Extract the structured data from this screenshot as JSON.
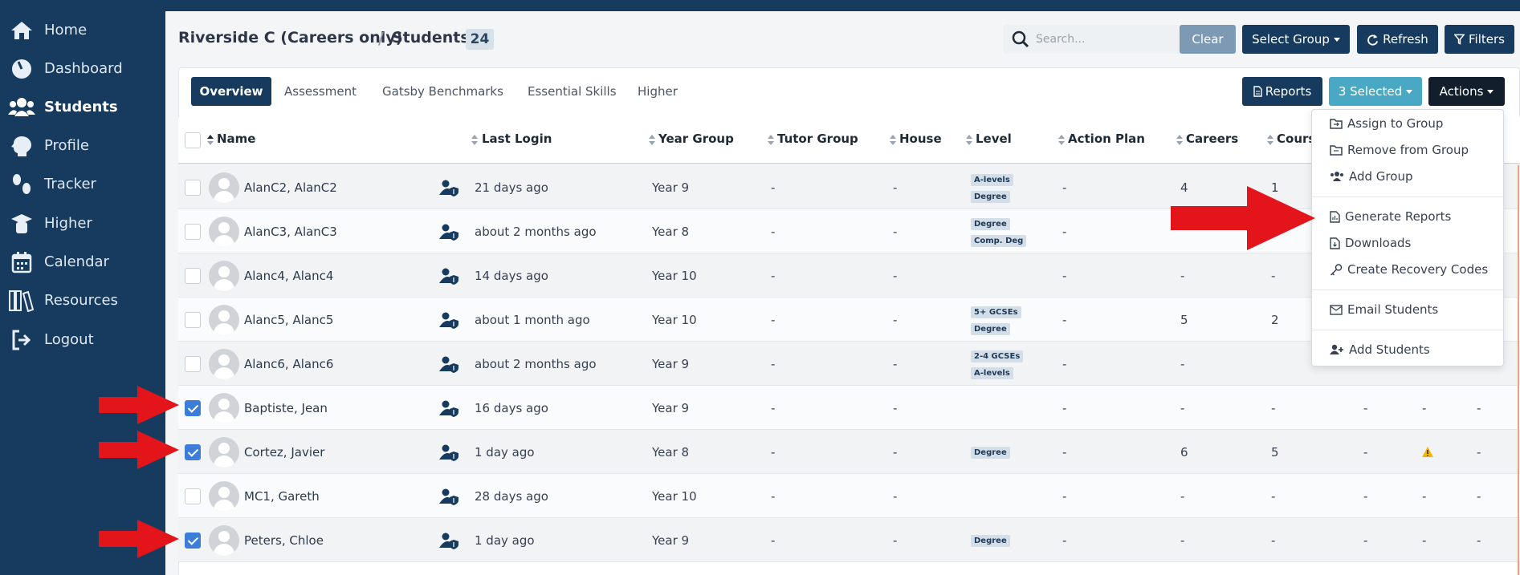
{
  "sidebar": {
    "items": [
      {
        "label": "Home",
        "icon": "home-icon"
      },
      {
        "label": "Dashboard",
        "icon": "dashboard-icon"
      },
      {
        "label": "Students",
        "icon": "students-icon",
        "active": true
      },
      {
        "label": "Profile",
        "icon": "profile-icon"
      },
      {
        "label": "Tracker",
        "icon": "tracker-icon"
      },
      {
        "label": "Higher",
        "icon": "graduation-cap-icon"
      },
      {
        "label": "Calendar",
        "icon": "calendar-icon"
      },
      {
        "label": "Resources",
        "icon": "books-icon"
      },
      {
        "label": "Logout",
        "icon": "logout-icon"
      }
    ]
  },
  "header": {
    "school": "Riverside C (Careers only)",
    "separator": "/",
    "page": "Students",
    "count": "24",
    "search_placeholder": "Search...",
    "clear_label": "Clear",
    "select_group_label": "Select Group",
    "refresh_label": "Refresh",
    "filters_label": "Filters"
  },
  "tabs": [
    "Overview",
    "Assessment",
    "Gatsby Benchmarks",
    "Essential Skills",
    "Higher"
  ],
  "toolbar": {
    "reports_label": "Reports",
    "selected_label": "3 Selected",
    "actions_label": "Actions"
  },
  "columns": [
    "Name",
    "Last Login",
    "Year Group",
    "Tutor Group",
    "House",
    "Level",
    "Action Plan",
    "Careers",
    "Cours"
  ],
  "rows": [
    {
      "name": "AlanC2, AlanC2",
      "last_login": "21 days ago",
      "year": "Year 9",
      "tutor": "-",
      "house": "-",
      "levels": [
        "A-levels",
        "Degree"
      ],
      "action_plan": "-",
      "careers": "4",
      "courses": "1",
      "checked": false
    },
    {
      "name": "AlanC3, AlanC3",
      "last_login": "about 2 months ago",
      "year": "Year 8",
      "tutor": "-",
      "house": "-",
      "levels": [
        "Degree",
        "Comp. Deg"
      ],
      "action_plan": "-",
      "careers": "",
      "courses": "",
      "checked": false
    },
    {
      "name": "Alanc4, Alanc4",
      "last_login": "14 days ago",
      "year": "Year 10",
      "tutor": "-",
      "house": "-",
      "levels": [],
      "action_plan": "-",
      "careers": "-",
      "courses": "-",
      "checked": false
    },
    {
      "name": "Alanc5, Alanc5",
      "last_login": "about 1 month ago",
      "year": "Year 10",
      "tutor": "-",
      "house": "-",
      "levels": [
        "5+ GCSEs",
        "Degree"
      ],
      "action_plan": "-",
      "careers": "5",
      "courses": "2",
      "checked": false
    },
    {
      "name": "Alanc6, Alanc6",
      "last_login": "about 2 months ago",
      "year": "Year 9",
      "tutor": "-",
      "house": "-",
      "levels": [
        "2-4 GCSEs",
        "A-levels"
      ],
      "action_plan": "-",
      "careers": "-",
      "courses": "",
      "checked": false
    },
    {
      "name": "Baptiste, Jean",
      "last_login": "16 days ago",
      "year": "Year 9",
      "tutor": "-",
      "house": "-",
      "levels": [],
      "action_plan": "-",
      "careers": "-",
      "courses": "-",
      "extra": [
        "-",
        "-",
        "-"
      ],
      "checked": true
    },
    {
      "name": "Cortez, Javier",
      "last_login": "1 day ago",
      "year": "Year 8",
      "tutor": "-",
      "house": "-",
      "levels": [
        "Degree"
      ],
      "action_plan": "-",
      "careers": "6",
      "courses": "5",
      "extra": [
        "-",
        "warning",
        "-"
      ],
      "checked": true
    },
    {
      "name": "MC1, Gareth",
      "last_login": "28 days ago",
      "year": "Year 10",
      "tutor": "-",
      "house": "-",
      "levels": [],
      "action_plan": "-",
      "careers": "-",
      "courses": "-",
      "extra": [
        "-",
        "-",
        "-"
      ],
      "checked": false
    },
    {
      "name": "Peters, Chloe",
      "last_login": "1 day ago",
      "year": "Year 9",
      "tutor": "-",
      "house": "-",
      "levels": [
        "Degree"
      ],
      "action_plan": "-",
      "careers": "-",
      "courses": "-",
      "extra": [
        "-",
        "-",
        "-"
      ],
      "checked": true
    }
  ],
  "actions_menu": [
    {
      "label": "Assign to Group",
      "icon": "folder-icon"
    },
    {
      "label": "Remove from Group",
      "icon": "folder-minus-icon"
    },
    {
      "label": "Add Group",
      "icon": "users-icon"
    },
    {
      "label": "Generate Reports",
      "icon": "file-report-icon"
    },
    {
      "label": "Downloads",
      "icon": "file-download-icon"
    },
    {
      "label": "Create Recovery Codes",
      "icon": "key-icon"
    },
    {
      "label": "Email Students",
      "icon": "envelope-icon"
    },
    {
      "label": "Add Students",
      "icon": "user-plus-icon"
    }
  ],
  "colors": {
    "sidebar": "#163b5f",
    "accent_teal": "#49a9c4",
    "checked": "#3b7dd8",
    "annotation_arrow": "#e3151b"
  }
}
